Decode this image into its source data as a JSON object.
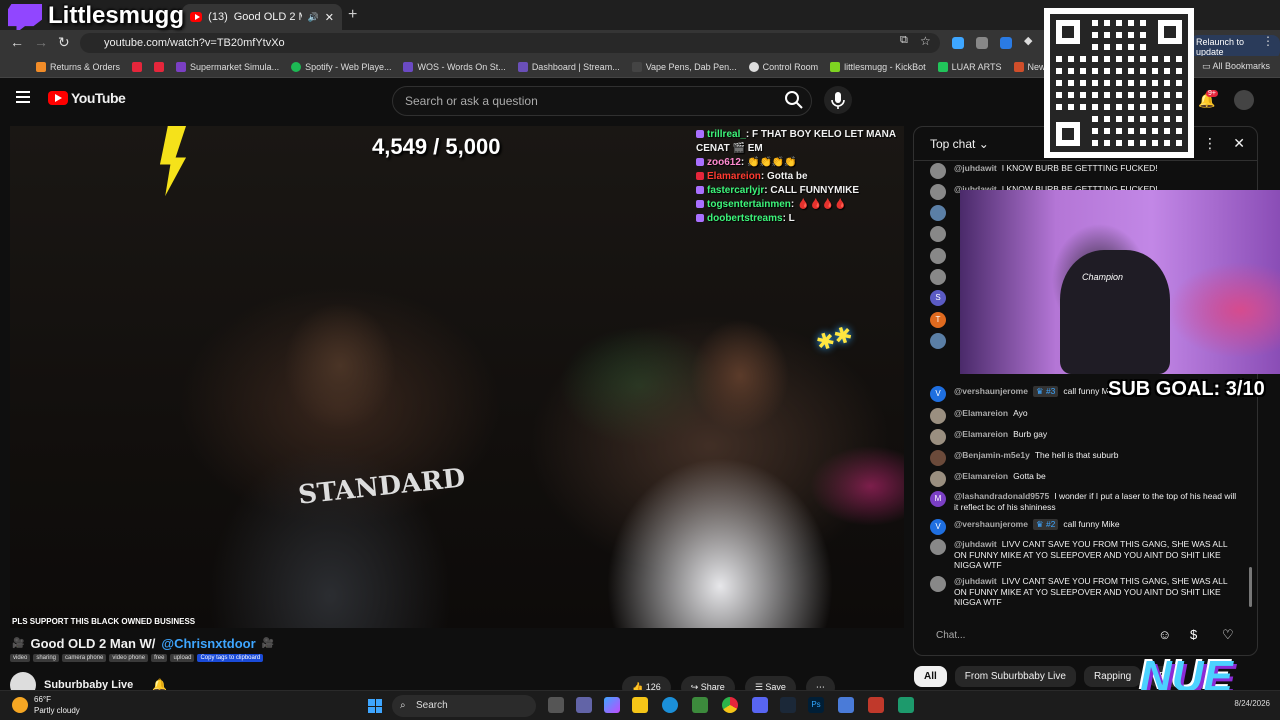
{
  "browser": {
    "tabs": [
      {
        "label": "(13)",
        "title": "Good OLD 2 Man W"
      }
    ],
    "url": "youtube.com/watch?v=TB20mfYtvXo",
    "update_label": "Relaunch to update",
    "bookmarks": [
      "Returns & Orders",
      "Supermarket Simula...",
      "Spotify - Web Playe...",
      "WOS - Words On St...",
      "Dashboard | Stream...",
      "Vape Pens, Dab Pen...",
      "Control Room",
      "littlesmugg - KickBot",
      "LUAR ARTS",
      "New Project - Studio",
      "My"
    ],
    "all_bookmarks": "All Bookmarks"
  },
  "youtube": {
    "logo": "YouTube",
    "search_placeholder": "Search or ask a question",
    "notification_count": "9+"
  },
  "stream": {
    "streamer_name": "Littlesmugg",
    "subgoal_counter": "4,549 / 5,000",
    "sub_goal_overlay": "SUB GOAL: 3/10",
    "ticker": "PLS SUPPORT THIS BLACK OWNED BUSINESS",
    "shirt_text": "STANDARD",
    "overlay_logo": "NUE",
    "webcam_brand": "Champion",
    "stream_chat": [
      {
        "name": "trillreal_",
        "text": ": F THAT BOY KELO LET MANA CENAT 🎬 EM",
        "color": "green"
      },
      {
        "name": "zoo612",
        "text": ": 👏👏👏👏",
        "color": "pink"
      },
      {
        "name": "Elamareion",
        "text": ": Gotta be",
        "color": "red"
      },
      {
        "name": "fastercarlyjr",
        "text": ": CALL FUNNYMIKE",
        "color": "green"
      },
      {
        "name": "togsentertainmen",
        "text": ": 🩸🩸🩸🩸",
        "color": "green"
      },
      {
        "name": "doobertstreams",
        "text": ": L",
        "color": "green"
      }
    ]
  },
  "video": {
    "title_prefix": "Good OLD 2 Man W/",
    "title_mention": "@Chrisnxtdoor",
    "tags": [
      "video",
      "sharing",
      "camera phone",
      "video phone",
      "free",
      "upload",
      "Copy tags to clipboard"
    ],
    "channel": "Suburbbaby Live",
    "like_count": "126",
    "share_label": "Share",
    "save_label": "Save"
  },
  "chat": {
    "header": "Top chat",
    "input_placeholder": "Chat...",
    "messages": [
      {
        "author": "@juhdawit",
        "text": "I KNOW BURB BE GETTTING FUCKED!",
        "avatar_color": "#888",
        "initial": ""
      },
      {
        "author": "@juhdawit",
        "text": "I KNOW BURB BE GETTTING FUCKED!",
        "avatar_color": "#888",
        "initial": ""
      },
      {
        "author": "@vershaunjerome",
        "badge": "#3",
        "text": "call funny Mike",
        "avatar_color": "#1f6fe0",
        "initial": "V"
      },
      {
        "author": "@Elamareion",
        "text": "Ayo",
        "avatar_color": "#9a8f80",
        "initial": ""
      },
      {
        "author": "@Elamareion",
        "text": "Burb gay",
        "avatar_color": "#9a8f80",
        "initial": ""
      },
      {
        "author": "@Benjamin-m5e1y",
        "text": "The hell is that suburb",
        "avatar_color": "#6b4a3a",
        "initial": ""
      },
      {
        "author": "@Elamareion",
        "text": "Gotta be",
        "avatar_color": "#9a8f80",
        "initial": ""
      },
      {
        "author": "@lashandradonald9575",
        "text": "I wonder if I put a laser to the top of his head will it reflect bc of his shininess",
        "avatar_color": "#7b3fc4",
        "initial": "M"
      },
      {
        "author": "@vershaunjerome",
        "badge": "#2",
        "text": "call funny Mike",
        "avatar_color": "#1f6fe0",
        "initial": "V"
      },
      {
        "author": "@juhdawit",
        "text": "LIVV CANT SAVE YOU FROM THIS GANG, SHE WAS ALL ON FUNNY MIKE AT YO SLEEPOVER AND YOU AINT DO SHIT LIKE NIGGA WTF",
        "avatar_color": "#888",
        "initial": ""
      },
      {
        "author": "@juhdawit",
        "text": "LIVV CANT SAVE YOU FROM THIS GANG, SHE WAS ALL ON FUNNY MIKE AT YO SLEEPOVER AND YOU AINT DO SHIT LIKE NIGGA WTF",
        "avatar_color": "#888",
        "initial": ""
      }
    ],
    "hidden_avatars": [
      {
        "color": "#5b7fa6",
        "initial": ""
      },
      {
        "color": "#888",
        "initial": ""
      },
      {
        "color": "#888",
        "initial": ""
      },
      {
        "color": "#888",
        "initial": ""
      },
      {
        "color": "#5b5bc4",
        "initial": "S"
      },
      {
        "color": "#e06a1f",
        "initial": "T"
      },
      {
        "color": "#5b7fa6",
        "initial": ""
      }
    ]
  },
  "chips": [
    "All",
    "From Suburbbaby Live",
    "Rapping",
    "Re"
  ],
  "taskbar": {
    "temperature": "66°F",
    "weather": "Partly cloudy",
    "search_label": "Search",
    "date": "8/24/2026"
  }
}
